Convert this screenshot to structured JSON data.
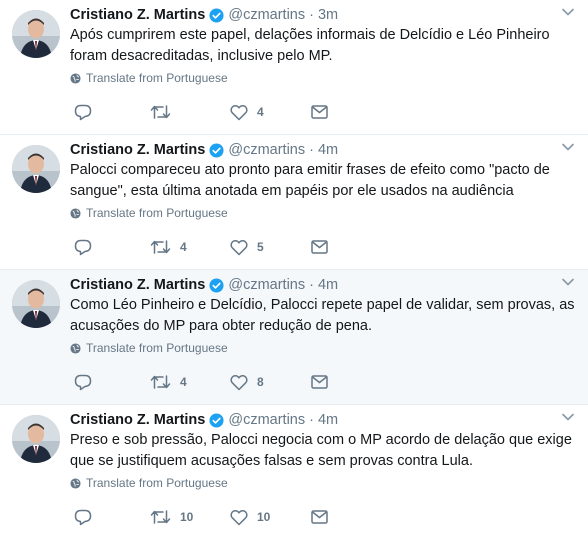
{
  "tweets": [
    {
      "name": "Cristiano Z. Martins",
      "handle": "@czmartins",
      "separator": "·",
      "time": "3m",
      "text": "Após cumprirem este papel, delações informais de Delcídio e Léo Pinheiro foram desacreditadas, inclusive pelo MP.",
      "translate_label": "Translate from Portuguese",
      "replies": "",
      "retweets": "",
      "likes": "4"
    },
    {
      "name": "Cristiano Z. Martins",
      "handle": "@czmartins",
      "separator": "·",
      "time": "4m",
      "text": "Palocci compareceu ato pronto para emitir frases de efeito como \"pacto de sangue\", esta última anotada em papéis por ele usados na audiência",
      "translate_label": "Translate from Portuguese",
      "replies": "",
      "retweets": "4",
      "likes": "5"
    },
    {
      "name": "Cristiano Z. Martins",
      "handle": "@czmartins",
      "separator": "·",
      "time": "4m",
      "text": "Como Léo Pinheiro e Delcídio, Palocci repete papel de validar, sem provas, as acusações do MP para obter redução de pena.",
      "translate_label": "Translate from Portuguese",
      "replies": "",
      "retweets": "4",
      "likes": "8"
    },
    {
      "name": "Cristiano Z. Martins",
      "handle": "@czmartins",
      "separator": "·",
      "time": "4m",
      "text": "Preso e sob pressão, Palocci negocia com o MP acordo de delação que exige que se justifiquem acusações falsas e sem provas contra Lula.",
      "translate_label": "Translate from Portuguese",
      "replies": "",
      "retweets": "10",
      "likes": "10"
    }
  ],
  "colors": {
    "text": "#14171a",
    "secondary": "#657786",
    "verified": "#1da1f2",
    "highlight_bg": "#f5f8fa",
    "border": "#e6ecf0"
  },
  "icons": {
    "verified": "verified-badge-icon",
    "caret": "chevron-down-icon",
    "globe": "globe-icon",
    "reply": "reply-icon",
    "retweet": "retweet-icon",
    "like": "heart-icon",
    "message": "envelope-icon"
  }
}
